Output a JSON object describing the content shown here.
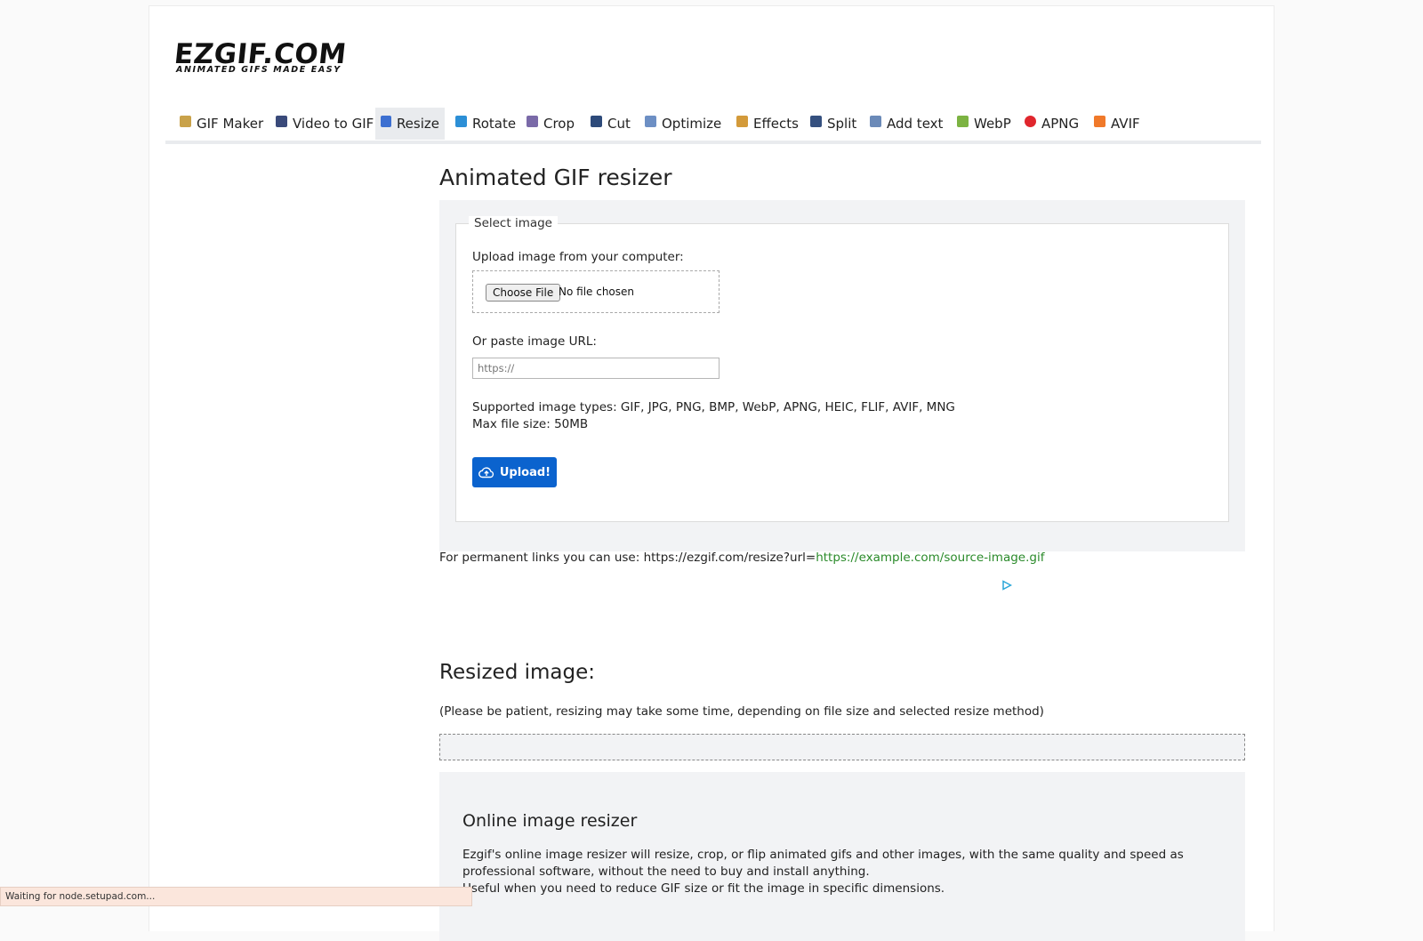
{
  "logo": {
    "main": "EZGIF.COM",
    "tagline": "ANIMATED GIFS MADE EASY"
  },
  "nav": [
    {
      "label": "GIF Maker",
      "icon": "gif-maker-icon",
      "color": "#c9a24a"
    },
    {
      "label": "Video to GIF",
      "icon": "film-icon",
      "color": "#3a4a7a"
    },
    {
      "label": "Resize",
      "icon": "resize-icon",
      "color": "#3c6fd1"
    },
    {
      "label": "Rotate",
      "icon": "rotate-icon",
      "color": "#2c8fd6"
    },
    {
      "label": "Crop",
      "icon": "crop-icon",
      "color": "#7a6aa8"
    },
    {
      "label": "Cut",
      "icon": "cut-icon",
      "color": "#2d4a7a"
    },
    {
      "label": "Optimize",
      "icon": "optimize-icon",
      "color": "#6d8fc4"
    },
    {
      "label": "Effects",
      "icon": "palette-icon",
      "color": "#d39a3a"
    },
    {
      "label": "Split",
      "icon": "split-icon",
      "color": "#35507f"
    },
    {
      "label": "Add text",
      "icon": "add-text-icon",
      "color": "#6b8ab8"
    },
    {
      "label": "WebP",
      "icon": "webp-icon",
      "color": "#7cb342"
    },
    {
      "label": "APNG",
      "icon": "apng-icon",
      "color": "#e0262d"
    },
    {
      "label": "AVIF",
      "icon": "avif-icon",
      "color": "#f0792a"
    }
  ],
  "active_tab": "Resize",
  "main": {
    "title": "Animated GIF resizer",
    "legend": "Select image",
    "upload_label": "Upload image from your computer:",
    "choose_file": "Choose File",
    "file_status": "No file chosen",
    "url_label": "Or paste image URL:",
    "url_placeholder": "https://",
    "supported": "Supported image types: GIF, JPG, PNG, BMP, WebP, APNG, HEIC, FLIF, AVIF, MNG",
    "max_size": "Max file size: 50MB",
    "upload_button": "Upload!",
    "accent": "#0b63ce"
  },
  "perm": {
    "prefix": "For permanent links you can use: https://ezgif.com/resize?url=",
    "link": "https://example.com/source-image.gif"
  },
  "result": {
    "title": "Resized image:",
    "note": "(Please be patient, resizing may take some time, depending on file size and selected resize method)"
  },
  "info": {
    "title": "Online image resizer",
    "p1": "Ezgif's online image resizer will resize, crop, or flip animated gifs and other images, with the same quality and speed as professional software, without the need to buy and install anything.",
    "p2": "Useful when you need to reduce GIF size or fit the image in specific dimensions."
  },
  "status_bar": "Waiting for node.setupad.com..."
}
